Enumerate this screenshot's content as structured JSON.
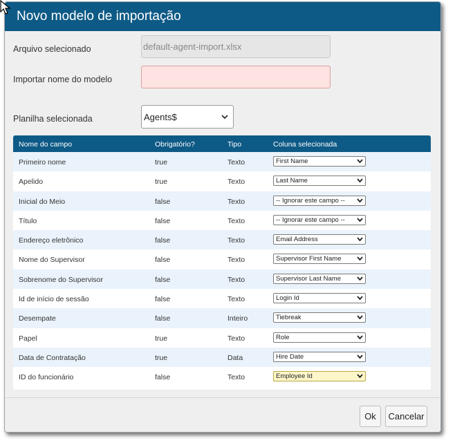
{
  "dialog": {
    "title": "Novo modelo de importação",
    "fields": {
      "file_label": "Arquivo selecionado",
      "file_value": "default-agent-import.xlsx",
      "model_name_label": "Importar nome do modelo",
      "model_name_value": "",
      "sheet_label": "Planilha selecionada",
      "sheet_value": "Agents$"
    },
    "table": {
      "headers": [
        "Nome do campo",
        "Obrigatório?",
        "Tipo",
        "Coluna selecionada"
      ],
      "rows": [
        {
          "field": "Primeiro nome",
          "required": "true",
          "type": "Texto",
          "column": "First Name"
        },
        {
          "field": "Apelido",
          "required": "true",
          "type": "Texto",
          "column": "Last Name"
        },
        {
          "field": "Inicial do Meio",
          "required": "false",
          "type": "Texto",
          "column": "-- Ignorar este campo --"
        },
        {
          "field": "Título",
          "required": "false",
          "type": "Texto",
          "column": "-- Ignorar este campo --"
        },
        {
          "field": "Endereço eletrônico",
          "required": "false",
          "type": "Texto",
          "column": "Email Address"
        },
        {
          "field": "Nome do Supervisor",
          "required": "false",
          "type": "Texto",
          "column": "Supervisor First Name"
        },
        {
          "field": "Sobrenome do Supervisor",
          "required": "false",
          "type": "Texto",
          "column": "Supervisor Last Name"
        },
        {
          "field": "Id de início de sessão",
          "required": "false",
          "type": "Texto",
          "column": "Login Id"
        },
        {
          "field": "Desempate",
          "required": "false",
          "type": "Inteiro",
          "column": "Tiebreak"
        },
        {
          "field": "Papel",
          "required": "true",
          "type": "Texto",
          "column": "Role"
        },
        {
          "field": "Data de Contratação",
          "required": "true",
          "type": "Data",
          "column": "Hire Date"
        },
        {
          "field": "ID do funcionário",
          "required": "false",
          "type": "Texto",
          "column": "Employee Id"
        }
      ]
    },
    "buttons": {
      "ok": "Ok",
      "cancel": "Cancelar"
    }
  },
  "colors": {
    "header_blue": "#0e5a86",
    "alt_row": "#eaf3fb",
    "error_field": "#fde3e1",
    "highlight_select": "#fdf6c9"
  },
  "icons": {
    "cursor": "mouse-pointer-icon",
    "dropdown": "chevron-down-icon"
  }
}
